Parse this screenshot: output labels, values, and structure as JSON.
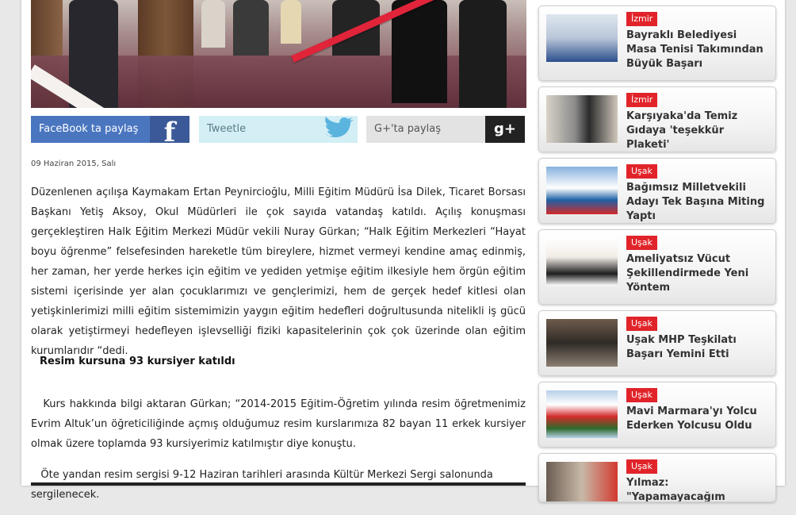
{
  "share": {
    "facebook_label": "FaceBook ta paylaş",
    "twitter_label": "Tweetle",
    "googleplus_label": "G+'ta paylaş"
  },
  "article": {
    "date": "09 Haziran 2015, Salı",
    "paragraph1": " Düzenlenen açılışa Kaymakam Ertan Peynircioğlu, Milli Eğitim Müdürü İsa Dilek, Ticaret Borsası Başkanı Yetiş Aksoy, Okul Müdürleri ile çok sayıda vatandaş katıldı. Açılış konuşması gerçekleştiren Halk Eğitim Merkezi Müdür vekili Nuray Gürkan; “Halk Eğitim Merkezleri “Hayat boyu öğrenme” felsefesinden hareketle tüm bireylere, hizmet vermeyi kendine amaç edinmiş, her zaman, her yerde herkes için eğitim ve yediden yetmişe eğitim ilkesiyle hem örgün eğitim sistemi içerisinde yer alan çocuklarımızı ve gençlerimizi, hem de gerçek hedef kitlesi olan yetişkinlerimizi milli eğitim sistemimizin yaygın eğitim hedefleri doğrultusunda nitelikli iş gücü olarak yetiştirmeyi hedefleyen işlevselliği fiziki kapasitelerinin çok çok üzerinde olan eğitim kurumlarıdır “dedi.",
    "subheading": "Resim kursuna 93 kursiyer katıldı",
    "paragraph2": "   Kurs hakkında bilgi aktaran Gürkan; “2014-2015 Eğitim-Öğretim yılında resim öğretmenimiz Evrim Altuk’un öğreticiliğinde açmış olduğumuz resim kurslarımıza 82 bayan 11 erkek kursiyer olmak üzere toplamda 93 kursiyerimiz katılmıştır diye konuştu.",
    "paragraph3": "   Öte yandan resim sergisi 9-12 Haziran tarihleri arasında Kültür Merkezi Sergi salonunda sergilenecek."
  },
  "sidebar": {
    "items": [
      {
        "category": "İzmir",
        "title": "Bayraklı Belediyesi Masa Tenisi Takımından Büyük Başarı"
      },
      {
        "category": "İzmir",
        "title": "Karşıyaka'da Temiz Gıdaya 'teşekkür Plaketi'"
      },
      {
        "category": "Uşak",
        "title": "Bağımsız Milletvekili Adayı Tek Başına Miting Yaptı"
      },
      {
        "category": "Uşak",
        "title": "Ameliyatsız Vücut Şekillendirmede Yeni Yöntem"
      },
      {
        "category": "Uşak",
        "title": "Uşak MHP Teşkilatı Başarı Yemini Etti"
      },
      {
        "category": "Uşak",
        "title": "Mavi Marmara'yı Yolcu Ederken Yolcusu Oldu"
      },
      {
        "category": "Uşak",
        "title": "Yılmaz: \"Yapamayacağım"
      }
    ]
  },
  "colors": {
    "badge": "#e0242a",
    "facebook": "#4a76c0",
    "twitter": "#d3eef5"
  }
}
